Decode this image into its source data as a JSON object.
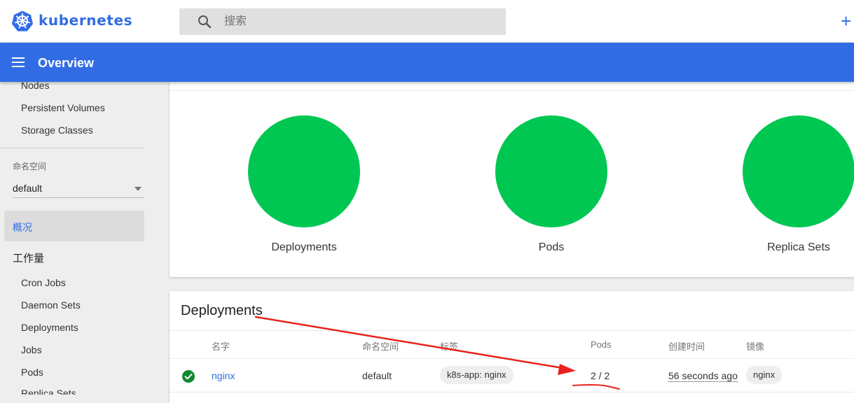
{
  "header": {
    "brand": "kubernetes",
    "search_placeholder": "搜索",
    "add_label": "+"
  },
  "titlebar": {
    "title": "Overview"
  },
  "sidebar": {
    "cluster_items": [
      {
        "label": "Nodes"
      },
      {
        "label": "Persistent Volumes"
      },
      {
        "label": "Storage Classes"
      }
    ],
    "namespace": {
      "label": "命名空间",
      "selected": "default"
    },
    "overview_label": "概况",
    "workloads": {
      "title": "工作量",
      "items": [
        {
          "label": "Cron Jobs"
        },
        {
          "label": "Daemon Sets"
        },
        {
          "label": "Deployments"
        },
        {
          "label": "Jobs"
        },
        {
          "label": "Pods"
        },
        {
          "label": "Replica Sets"
        }
      ]
    }
  },
  "status_card": {
    "items": [
      {
        "label": "Deployments"
      },
      {
        "label": "Pods"
      },
      {
        "label": "Replica Sets"
      }
    ]
  },
  "deployments_card": {
    "title": "Deployments",
    "columns": [
      "名字",
      "命名空间",
      "标签",
      "Pods",
      "创建时间",
      "镜像"
    ],
    "rows": [
      {
        "name": "nginx",
        "namespace": "default",
        "label": "k8s-app: nginx",
        "pods": "2 / 2",
        "created": "56 seconds ago",
        "image": "nginx"
      }
    ]
  },
  "colors": {
    "accent": "#326ce5",
    "status_ok": "#00c752",
    "annotation": "#e8211e"
  }
}
